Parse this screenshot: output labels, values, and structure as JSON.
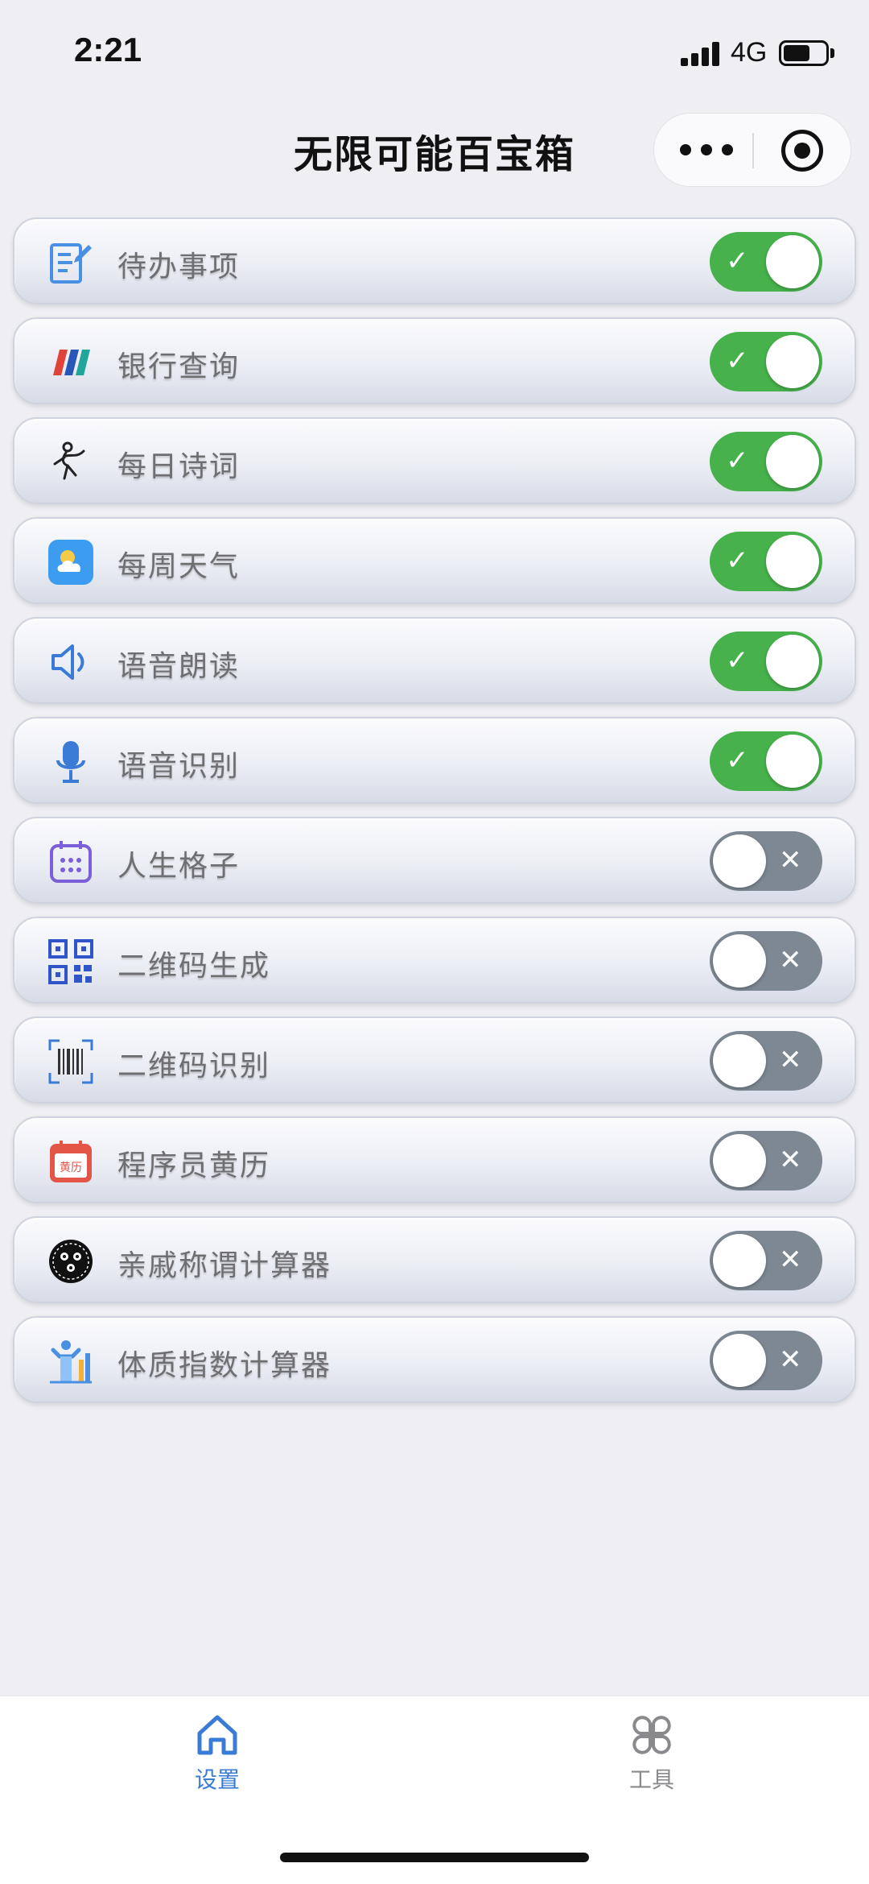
{
  "status_bar": {
    "time": "2:21",
    "network": "4G"
  },
  "header": {
    "title": "无限可能百宝箱"
  },
  "items": [
    {
      "label": "待办事项",
      "enabled": true,
      "icon": "todo-icon"
    },
    {
      "label": "银行查询",
      "enabled": true,
      "icon": "bank-cards-icon"
    },
    {
      "label": "每日诗词",
      "enabled": true,
      "icon": "poem-figure-icon"
    },
    {
      "label": "每周天气",
      "enabled": true,
      "icon": "weather-icon"
    },
    {
      "label": "语音朗读",
      "enabled": true,
      "icon": "speaker-icon"
    },
    {
      "label": "语音识别",
      "enabled": true,
      "icon": "microphone-icon"
    },
    {
      "label": "人生格子",
      "enabled": false,
      "icon": "calendar-grid-icon"
    },
    {
      "label": "二维码生成",
      "enabled": false,
      "icon": "qr-code-icon"
    },
    {
      "label": "二维码识别",
      "enabled": false,
      "icon": "barcode-scan-icon"
    },
    {
      "label": "程序员黄历",
      "enabled": false,
      "icon": "almanac-icon",
      "icon_text": "黄历"
    },
    {
      "label": "亲戚称谓计算器",
      "enabled": false,
      "icon": "family-icon"
    },
    {
      "label": "体质指数计算器",
      "enabled": false,
      "icon": "bmi-icon"
    }
  ],
  "tabs": {
    "home": {
      "label": "设置",
      "icon": "home-icon",
      "active": true
    },
    "tools": {
      "label": "工具",
      "icon": "clover-grid-icon",
      "active": false
    }
  },
  "colors": {
    "switch_on": "#47b24b",
    "switch_off": "#7e8892",
    "tab_active": "#3a7bd5"
  }
}
